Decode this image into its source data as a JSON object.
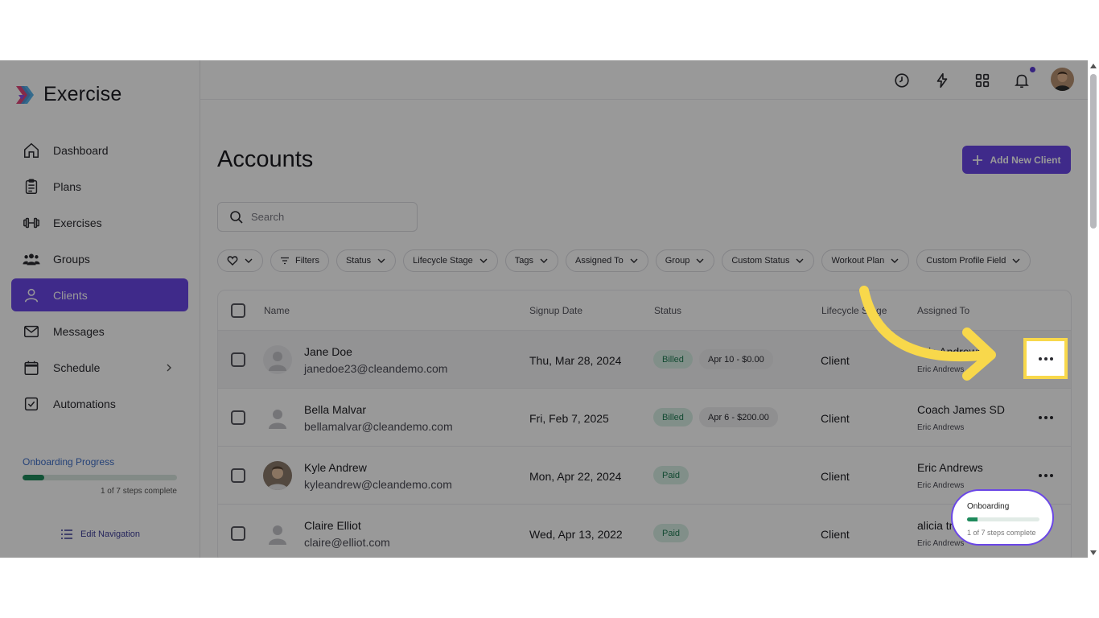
{
  "app": {
    "name": "Exercise"
  },
  "sidebar": {
    "items": [
      {
        "label": "Dashboard",
        "icon": "home-icon"
      },
      {
        "label": "Plans",
        "icon": "clipboard-icon"
      },
      {
        "label": "Exercises",
        "icon": "dumbbell-icon"
      },
      {
        "label": "Groups",
        "icon": "users-icon"
      },
      {
        "label": "Clients",
        "icon": "user-icon",
        "active": true
      },
      {
        "label": "Messages",
        "icon": "mail-icon"
      },
      {
        "label": "Schedule",
        "icon": "calendar-icon",
        "has_chevron": true
      },
      {
        "label": "Automations",
        "icon": "checkbox-icon"
      }
    ],
    "onboarding": {
      "title": "Onboarding Progress",
      "steps": "1 of 7 steps complete",
      "progress": 0.14
    },
    "edit_navigation": "Edit Navigation"
  },
  "topbar": {
    "icons": [
      "clock-icon",
      "lightning-icon",
      "grid-icon",
      "bell-icon",
      "avatar"
    ]
  },
  "main": {
    "title": "Accounts",
    "add_button": "Add New Client",
    "search_placeholder": "Search",
    "filters": [
      "Filters",
      "Status",
      "Lifecycle Stage",
      "Tags",
      "Assigned To",
      "Group",
      "Custom Status",
      "Workout Plan",
      "Custom Profile Field"
    ],
    "table": {
      "columns": [
        "Name",
        "Signup Date",
        "Status",
        "Lifecycle Stage",
        "Assigned To"
      ],
      "rows": [
        {
          "name": "Jane Doe",
          "email": "janedoe23@cleandemo.com",
          "signup": "Thu, Mar 28, 2024",
          "status": "Billed",
          "invoice": "Apr 10 - $0.00",
          "stage": "Client",
          "assigned": "Eric Andrews",
          "assigned_sub": "Eric Andrews"
        },
        {
          "name": "Bella Malvar",
          "email": "bellamalvar@cleandemo.com",
          "signup": "Fri, Feb 7, 2025",
          "status": "Billed",
          "invoice": "Apr 6 - $200.00",
          "stage": "Client",
          "assigned": "Coach James SD",
          "assigned_sub": "Eric Andrews"
        },
        {
          "name": "Kyle Andrew",
          "email": "kyleandrew@cleandemo.com",
          "signup": "Mon, Apr 22, 2024",
          "status": "Paid",
          "invoice": "",
          "stage": "Client",
          "assigned": "Eric Andrews",
          "assigned_sub": "Eric Andrews"
        },
        {
          "name": "Claire Elliot",
          "email": "claire@elliot.com",
          "signup": "Wed, Apr 13, 2022",
          "status": "Paid",
          "invoice": "",
          "stage": "Client",
          "assigned": "alicia tr",
          "assigned_sub": "Eric Andrews"
        }
      ]
    }
  },
  "onboarding_popup": {
    "title": "Onboarding",
    "steps": "1 of 7 steps complete",
    "progress": 0.14
  },
  "colors": {
    "accent": "#6a46e6",
    "highlight": "#f8d84b",
    "paid_badge_bg": "#d7efe4",
    "paid_badge_text": "#1e7b53"
  }
}
